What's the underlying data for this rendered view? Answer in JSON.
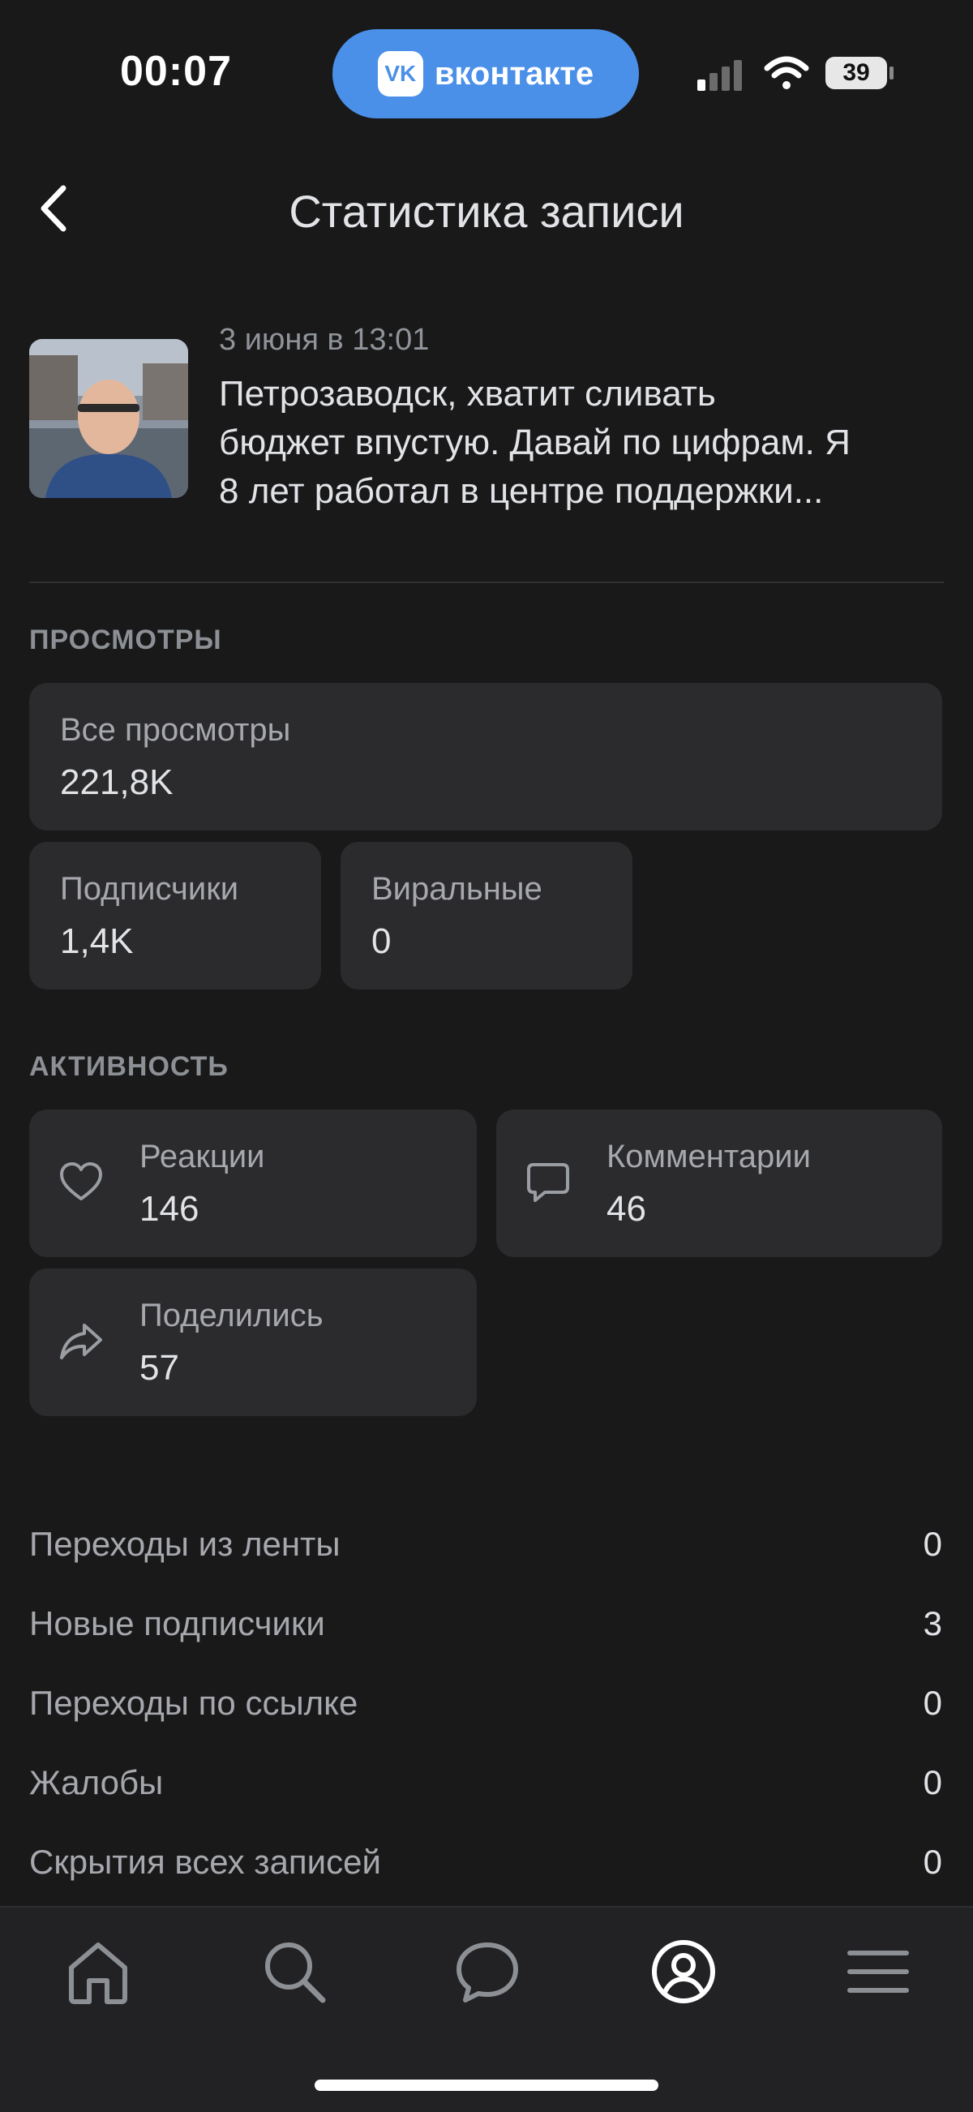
{
  "status_bar": {
    "time": "00:07",
    "app_pill": "вконтакте",
    "app_pill_logo": "VK",
    "battery": "39"
  },
  "header": {
    "title": "Статистика записи"
  },
  "post": {
    "date": "3 июня в 13:01",
    "text_lines": [
      "Петрозаводск, хватит сливать",
      "бюджет впустую. Давай по цифрам. Я",
      "8 лет работал в центре поддержки..."
    ]
  },
  "views": {
    "section_title": "ПРОСМОТРЫ",
    "all": {
      "label": "Все просмотры",
      "value": "221,8K"
    },
    "subscribers": {
      "label": "Подписчики",
      "value": "1,4K"
    },
    "viral": {
      "label": "Виральные",
      "value": "0"
    }
  },
  "activity": {
    "section_title": "АКТИВНОСТЬ",
    "reactions": {
      "label": "Реакции",
      "value": "146",
      "icon": "heart-icon"
    },
    "comments": {
      "label": "Комментарии",
      "value": "46",
      "icon": "comment-icon"
    },
    "shares": {
      "label": "Поделились",
      "value": "57",
      "icon": "share-icon"
    }
  },
  "stats": [
    {
      "label": "Переходы из ленты",
      "value": "0"
    },
    {
      "label": "Новые подписчики",
      "value": "3"
    },
    {
      "label": "Переходы по ссылке",
      "value": "0"
    },
    {
      "label": "Жалобы",
      "value": "0"
    },
    {
      "label": "Скрытия всех записей",
      "value": "0"
    }
  ],
  "tabbar": {
    "items": [
      "home-icon",
      "search-icon",
      "messages-icon",
      "profile-icon",
      "menu-icon"
    ],
    "active": "profile-icon"
  },
  "colors": {
    "background": "#19191a",
    "card": "#2b2b2d",
    "accent": "#4a90e8",
    "text": "#e1e3e6",
    "secondary": "#a6a8ad"
  }
}
